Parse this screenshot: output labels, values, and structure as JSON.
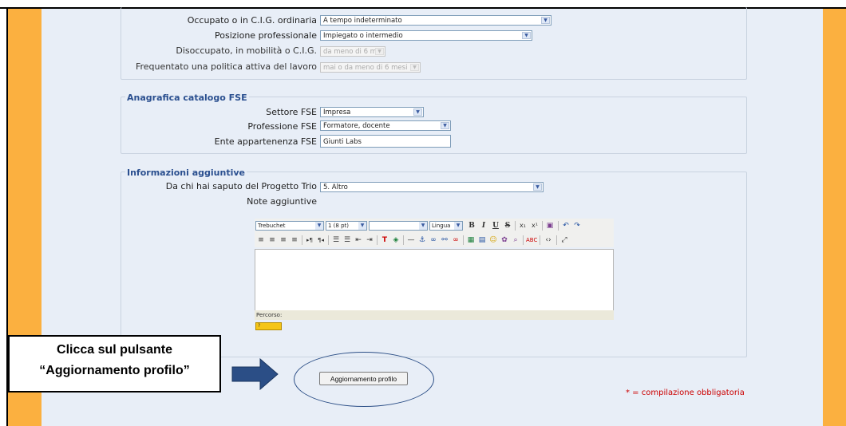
{
  "lavoro": {
    "occupato_label": "Occupato o in C.I.G. ordinaria",
    "occupato_value": "A tempo indeterminato",
    "posizione_label": "Posizione professionale",
    "posizione_value": "Impiegato o intermedio",
    "disoccupato_label": "Disoccupato, in mobilità o C.I.G.",
    "disoccupato_value": "da meno di 6 mesi",
    "politica_label": "Frequentato una politica attiva del lavoro",
    "politica_value": "mai o da meno di 6 mesi"
  },
  "fse": {
    "legend": "Anagrafica catalogo FSE",
    "settore_label": "Settore FSE",
    "settore_value": "Impresa",
    "professione_label": "Professione FSE",
    "professione_value": "Formatore, docente",
    "ente_label": "Ente appartenenza FSE",
    "ente_value": "Giunti Labs"
  },
  "info": {
    "legend": "Informazioni aggiuntive",
    "progetto_label": "Da chi hai saputo del Progetto Trio",
    "progetto_value": "5. Altro",
    "note_label": "Note aggiuntive"
  },
  "editor": {
    "font_value": "Trebuchet",
    "size_value": "1 (8 pt)",
    "format_value": "",
    "lang_value": "Lingua",
    "path_label": "Percorso:",
    "help_label": "?"
  },
  "submit_label": "Aggiornamento profilo",
  "required_note": "* = compilazione obbligatoria",
  "callout": {
    "line1": "Clicca sul pulsante",
    "line2": "“Aggiornamento profilo”"
  },
  "colors": {
    "side_orange": "#fbb040",
    "content_bg": "#e8eef7",
    "legend_blue": "#2a4f8f",
    "arrow_blue": "#2b4e86",
    "required_red": "#cc0000"
  }
}
